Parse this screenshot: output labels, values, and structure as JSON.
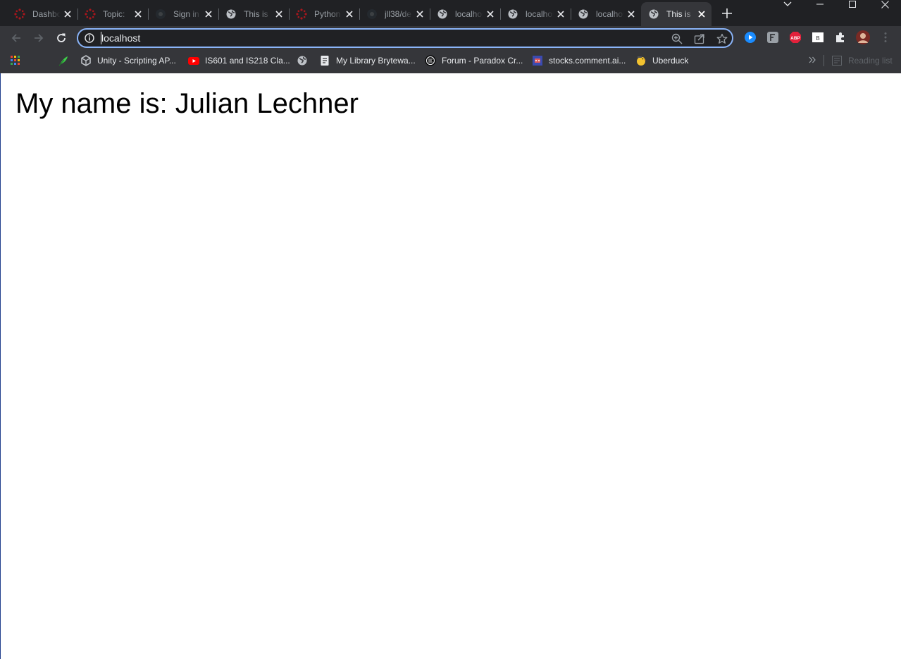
{
  "browser": {
    "tabs": [
      {
        "title": "Dashboard",
        "icon": "canvas-icon",
        "active": false
      },
      {
        "title": "Topic: ",
        "icon": "canvas-icon",
        "active": false
      },
      {
        "title": "Sign in",
        "icon": "github-icon",
        "active": false
      },
      {
        "title": "This is",
        "icon": "globe-icon",
        "active": false
      },
      {
        "title": "Python",
        "icon": "canvas-icon",
        "active": false
      },
      {
        "title": "jll38/de",
        "icon": "github-icon",
        "active": false
      },
      {
        "title": "localhost",
        "icon": "globe-icon",
        "active": false
      },
      {
        "title": "localhost",
        "icon": "globe-icon",
        "active": false
      },
      {
        "title": "localhost",
        "icon": "globe-icon",
        "active": false
      },
      {
        "title": "This is",
        "icon": "globe-icon",
        "active": true
      }
    ],
    "address_bar": {
      "url": "localhost"
    },
    "bookmarks": [
      {
        "label": "",
        "icon": "apps-grid-icon"
      },
      {
        "label": "",
        "icon": "feather-icon"
      },
      {
        "label": "Unity - Scripting AP...",
        "icon": "unity-icon"
      },
      {
        "label": "IS601 and IS218 Cla...",
        "icon": "youtube-icon"
      },
      {
        "label": "",
        "icon": "globe-icon"
      },
      {
        "label": "My Library Brytewa...",
        "icon": "document-icon"
      },
      {
        "label": "Forum - Paradox Cr...",
        "icon": "paradox-icon"
      },
      {
        "label": "stocks.comment.ai...",
        "icon": "robot-icon"
      },
      {
        "label": "Uberduck",
        "icon": "duck-icon"
      }
    ],
    "reading_list_label": "Reading list",
    "colors": {
      "accent": "#8ab4f8",
      "toolbar": "#35363a",
      "tabstrip": "#202124"
    }
  },
  "page": {
    "heading": "My name is: Julian Lechner"
  }
}
